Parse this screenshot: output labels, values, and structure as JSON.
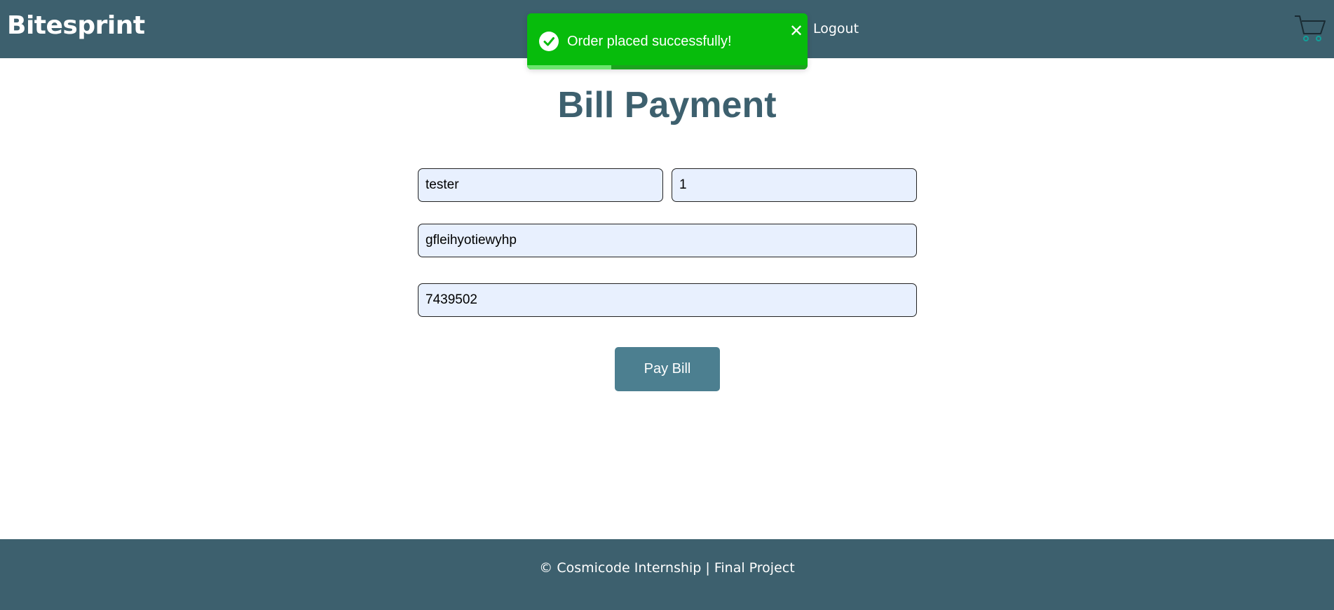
{
  "header": {
    "brand": "Bitesprint",
    "logout_label": "Logout",
    "cart_icon": "cart-icon",
    "background": "#3d606e"
  },
  "toast": {
    "message": "Order placed successfully!",
    "close_symbol": "✕",
    "progress": 0.3,
    "background": "#07bc0c",
    "icon": "check-circle-icon"
  },
  "main": {
    "title": "Bill Payment",
    "fields": {
      "name": "tester",
      "quantity": "1",
      "address": "gfleihyotiewyhp",
      "phone": "7439502"
    },
    "pay_button_label": "Pay Bill",
    "accent": "#4c7f90"
  },
  "footer": {
    "text": "© Cosmicode Internship | Final Project"
  }
}
